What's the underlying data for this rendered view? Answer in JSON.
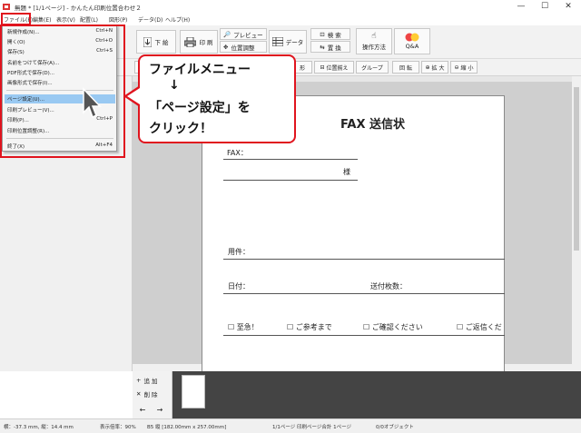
{
  "titlebar": {
    "title": "無題 * [1/1ページ] - かんたん印刷位置合わせ２",
    "minimize": "—",
    "maximize": "☐",
    "close": "✕"
  },
  "menubar": {
    "items": [
      "ファイル(F)",
      "編集(E)",
      "表示(V)",
      "配置(L)",
      "図形(P)",
      "データ(D)",
      "ヘルプ(H)"
    ]
  },
  "toolbar": {
    "download": "下 絵",
    "print": "印 刷",
    "preview": "プレビュー",
    "position_adjust": "位置調整",
    "data": "データ",
    "search": "検 索",
    "replace": "置 換",
    "howto": "操作方法",
    "qa": "Q&A"
  },
  "toolbar2": {
    "shape": "形",
    "align": "位置揃え",
    "group": "グループ",
    "rotate": "回 転",
    "zoom_in": "拡 大",
    "zoom_out": "縮 小"
  },
  "file_menu": {
    "items": [
      {
        "label": "新規作成(N)...",
        "shortcut": "Ctrl+N"
      },
      {
        "label": "開く(O)",
        "shortcut": "Ctrl+O"
      },
      {
        "label": "保存(S)",
        "shortcut": "Ctrl+S"
      },
      {
        "label": "名前をつけて保存(A)...",
        "shortcut": ""
      },
      {
        "label": "PDF形式で保存(D)...",
        "shortcut": ""
      },
      {
        "label": "画像形式で保存(I)...",
        "shortcut": ""
      },
      {
        "label": "ページ設定(U)...",
        "shortcut": ""
      },
      {
        "label": "印刷プレビュー(V)...",
        "shortcut": ""
      },
      {
        "label": "印刷(P)...",
        "shortcut": "Ctrl+P"
      },
      {
        "label": "印刷位置調整(R)...",
        "shortcut": ""
      },
      {
        "label": "終了(X)",
        "shortcut": "Alt+F4"
      }
    ]
  },
  "callout": {
    "line1": "ファイルメニュー",
    "line2": "↓",
    "line3": "「ページ設定」を",
    "line4": "クリック！"
  },
  "document": {
    "title": "FAX 送信状",
    "fax_label": "FAX：",
    "sama": "様",
    "subject_label": "用件：",
    "date_label": "日付：",
    "pages_label": "送付枚数：",
    "check1": "☐ 至急！",
    "check2": "☐ ご参考まで",
    "check3": "☐ ご確認ください",
    "check4": "☐ ご返信くだ"
  },
  "thumb_panel": {
    "add": "追 加",
    "delete": "削 除",
    "left": "←",
    "right": "→"
  },
  "statusbar": {
    "coords": "横：-37.3 mm, 縦：14.4 mm",
    "zoom": "表示倍率：90%",
    "paper": "B5 縦 [182.00mm x 257.00mm]",
    "pages": "1/1ページ 印刷ページ合計 1ページ",
    "objects": "0/0オブジェクト"
  },
  "colors": {
    "highlight_red": "#e0141e",
    "menu_highlight": "#99c9f2"
  }
}
